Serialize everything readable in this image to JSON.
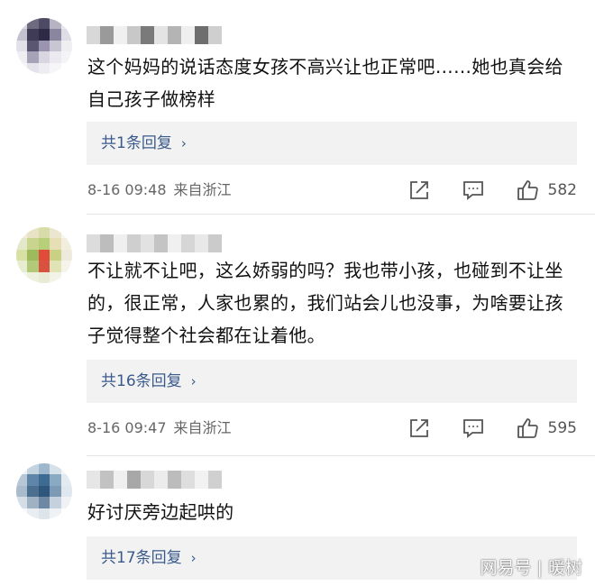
{
  "comments": [
    {
      "text": "这个妈妈的说话态度女孩不高兴让也正常吧……她也真会给自己孩子做榜样",
      "replies_label": "共1条回复",
      "date": "8-16 09:48",
      "region": "来自浙江",
      "likes": "582",
      "avatar_palette": [
        "#d9d7dd",
        "#6e6a80",
        "#4d4a63",
        "#b7b3c3",
        "#e8e7ec",
        "#c4c1cf",
        "#3f3b57",
        "#2e2a45",
        "#8a86a0",
        "#dedce4",
        "#e2e0e8",
        "#5a5672",
        "#9a94b0",
        "#c8c6d2",
        "#efeff2",
        "#efeff2",
        "#a6a2b8",
        "#d8d6e0",
        "#eceaf0",
        "#f4f4f6",
        "#f6f6f8",
        "#e4e2ea",
        "#eeeef2",
        "#f6f6f8",
        "#ffffff"
      ],
      "name_palette": [
        "#d8d8d8",
        "#9a9a9a",
        "#f0f0f0",
        "#c8c8c8",
        "#7a7a7a",
        "#e4e4e4",
        "#b4b4b4",
        "#efefef",
        "#6e6e6e",
        "#cfcfcf"
      ]
    },
    {
      "text": "不让就不让吧，这么娇弱的吗？我也带小孩，也碰到不让坐的，很正常，人家也累的，我们站会儿也没事，为啥要让孩子觉得整个社会都在让着他。",
      "replies_label": "共16条回复",
      "date": "8-16 09:47",
      "region": "来自浙江",
      "likes": "595",
      "avatar_palette": [
        "#f2efe0",
        "#e8e3c6",
        "#d7dca8",
        "#eae6cf",
        "#f7f6ee",
        "#e3e8c8",
        "#c9d58f",
        "#b8cf7a",
        "#e6dfb5",
        "#f1eedd",
        "#d9e0a4",
        "#9dbb5c",
        "#e24a3a",
        "#c9d184",
        "#eeeadb",
        "#e8ecd0",
        "#b3c97a",
        "#d8523f",
        "#dfe3b6",
        "#f5f3ea",
        "#f6f6f0",
        "#eef0de",
        "#e9ebd5",
        "#f3f3ea",
        "#ffffff"
      ],
      "name_palette": [
        "#dcdcdc",
        "#bdbdbd",
        "#efefef",
        "#cfcfcf",
        "#e2e2e2",
        "#c4c4c4",
        "#f0f0f0",
        "#d6d6d6",
        "#e8e8e8",
        "#cbcbcb"
      ]
    },
    {
      "text": "好讨厌旁边起哄的",
      "replies_label": "共17条回复",
      "avatar_palette": [
        "#eef2f5",
        "#c3d3e0",
        "#9db7cc",
        "#d6e1ea",
        "#f2f5f7",
        "#b7c7d6",
        "#5f86a8",
        "#3e6b92",
        "#8aa9c2",
        "#e4ebf0",
        "#a9bccd",
        "#4d6f8f",
        "#2f577c",
        "#7d9ab5",
        "#dfe7ee",
        "#d5dee6",
        "#9fb2c4",
        "#6d88a2",
        "#c5d1dc",
        "#eef2f5",
        "#f5f7f9",
        "#e8edf1",
        "#dde4ea",
        "#eef2f5",
        "#ffffff"
      ],
      "name_palette": [
        "#e6e6e6",
        "#c2c2c2",
        "#f0f0f0",
        "#a8a8a8",
        "#d8d8d8",
        "#ececec",
        "#bcbcbc",
        "#dedede",
        "#f2f2f2",
        "#d0d0d0"
      ]
    }
  ],
  "watermark": "网易号 | 暖树",
  "icons": {
    "share": "share-icon",
    "reply": "comment-icon",
    "like": "thumbs-up-icon"
  },
  "colors": {
    "link": "#3b5a8c",
    "meta": "#666666",
    "reply_bg": "#f2f2f2",
    "icon": "#555555"
  }
}
